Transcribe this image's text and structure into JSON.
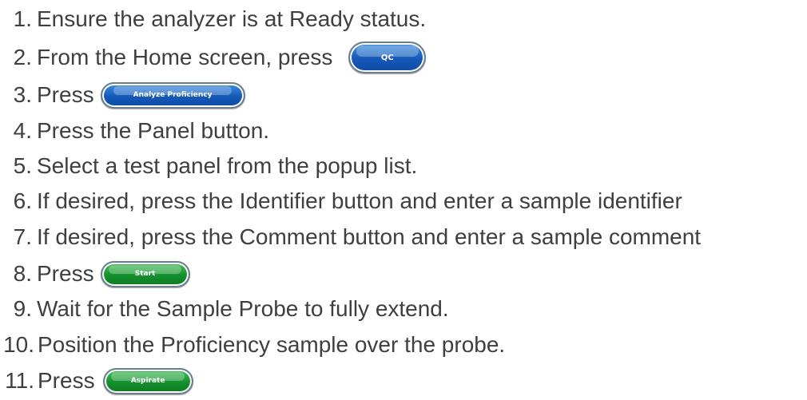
{
  "steps": [
    {
      "num": "1.",
      "text": "Ensure the analyzer is at Ready status."
    },
    {
      "num": "2.",
      "text": "From the Home screen, press",
      "button": "QC"
    },
    {
      "num": "3.",
      "text": "Press",
      "button": "Analyze Proficiency"
    },
    {
      "num": "4.",
      "text": "Press the Panel button."
    },
    {
      "num": "5.",
      "text": "Select a test panel from the popup list."
    },
    {
      "num": "6.",
      "text": "If desired, press the Identifier button and enter a sample identifier"
    },
    {
      "num": "7.",
      "text": "If desired, press the Comment button and enter a sample comment"
    },
    {
      "num": "8.",
      "text": "Press",
      "button": "Start"
    },
    {
      "num": "9.",
      "text": "Wait for the Sample Probe to fully extend."
    },
    {
      "num": "10.",
      "text": "Position the Proficiency sample over the probe."
    },
    {
      "num": "11.",
      "text": "Press",
      "button": "Aspirate"
    }
  ],
  "colors": {
    "text": "#3f3f3f",
    "button_blue": "#1559b8",
    "button_green": "#15902e"
  }
}
